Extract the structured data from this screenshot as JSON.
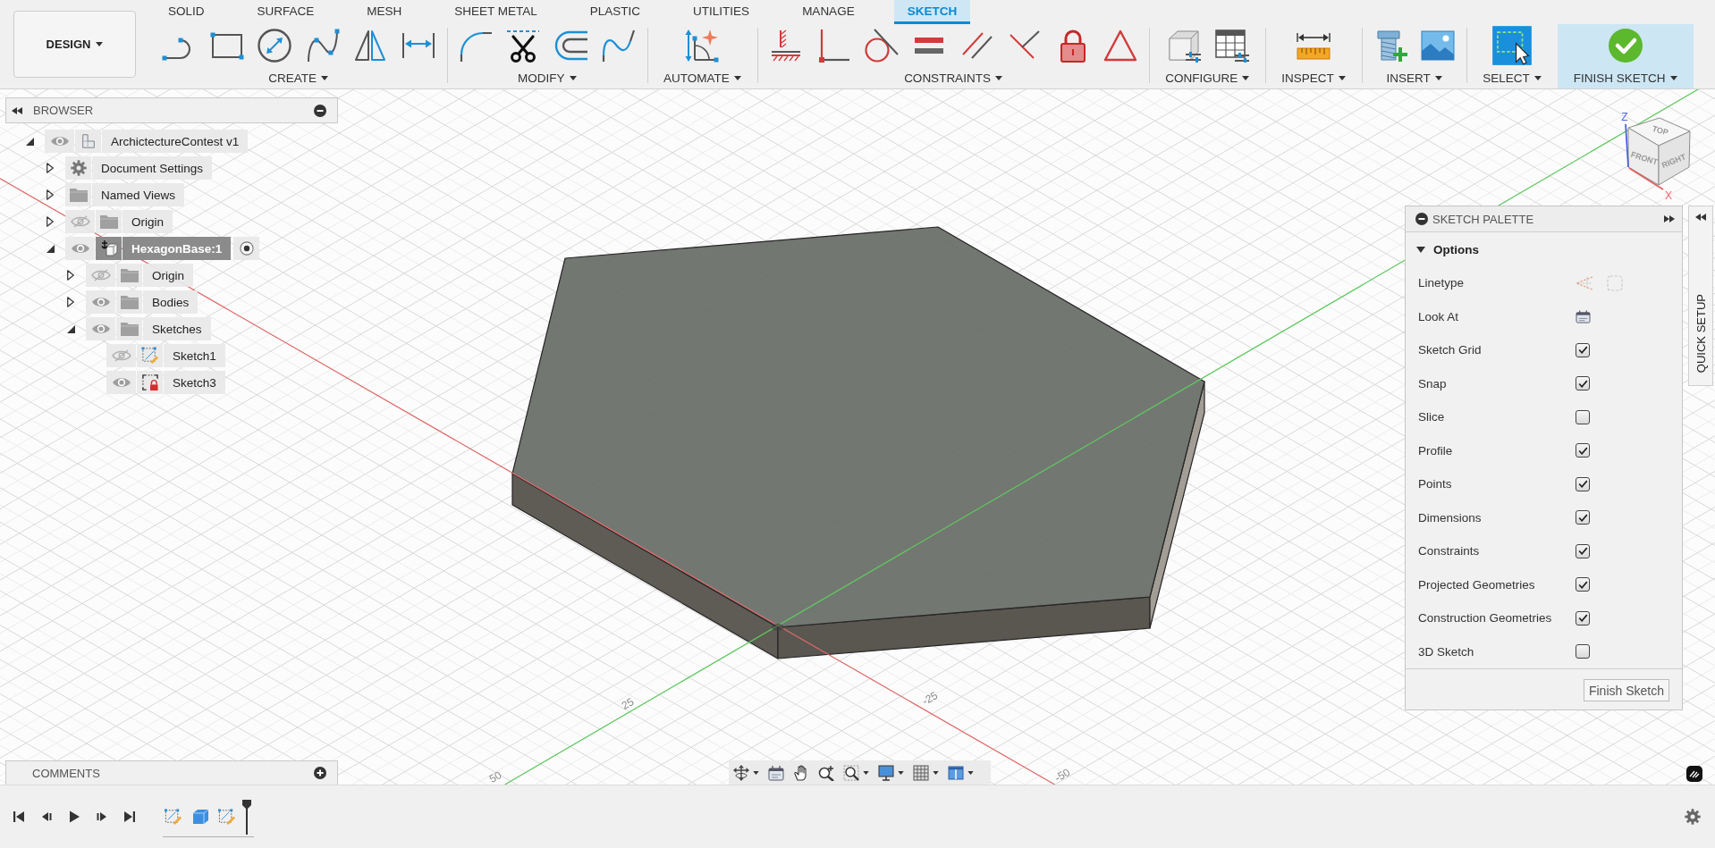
{
  "workspace_button": {
    "label": "DESIGN"
  },
  "tabs": [
    {
      "label": "SOLID",
      "selected": false
    },
    {
      "label": "SURFACE",
      "selected": false
    },
    {
      "label": "MESH",
      "selected": false
    },
    {
      "label": "SHEET METAL",
      "selected": false
    },
    {
      "label": "PLASTIC",
      "selected": false
    },
    {
      "label": "UTILITIES",
      "selected": false
    },
    {
      "label": "MANAGE",
      "selected": false
    },
    {
      "label": "SKETCH",
      "selected": true
    }
  ],
  "tool_groups": [
    {
      "label": "CREATE",
      "highlighted": false,
      "tools": [
        {
          "kind": "line"
        },
        {
          "kind": "rectangle"
        },
        {
          "kind": "circle"
        },
        {
          "kind": "spline"
        },
        {
          "kind": "mirror"
        },
        {
          "kind": "dimension"
        }
      ]
    },
    {
      "label": "MODIFY",
      "highlighted": false,
      "tools": [
        {
          "kind": "fillet"
        },
        {
          "kind": "trim"
        },
        {
          "kind": "offset"
        },
        {
          "kind": "extend"
        }
      ]
    },
    {
      "label": "AUTOMATE",
      "highlighted": false,
      "tools": [
        {
          "kind": "automate"
        }
      ]
    },
    {
      "label": "CONSTRAINTS",
      "highlighted": false,
      "tools": [
        {
          "kind": "horizontal"
        },
        {
          "kind": "coincident"
        },
        {
          "kind": "tangent"
        },
        {
          "kind": "equal"
        },
        {
          "kind": "parallel"
        },
        {
          "kind": "perpendicular"
        },
        {
          "kind": "fix"
        },
        {
          "kind": "symmetry"
        }
      ]
    },
    {
      "label": "CONFIGURE",
      "highlighted": false,
      "tools": [
        {
          "kind": "parameters"
        },
        {
          "kind": "table"
        }
      ]
    },
    {
      "label": "INSPECT",
      "highlighted": false,
      "tools": [
        {
          "kind": "measure"
        }
      ]
    },
    {
      "label": "INSERT",
      "highlighted": false,
      "tools": [
        {
          "kind": "insert"
        },
        {
          "kind": "image"
        }
      ]
    },
    {
      "label": "SELECT",
      "highlighted": false,
      "tools": [
        {
          "kind": "select"
        }
      ]
    },
    {
      "label": "FINISH SKETCH",
      "highlighted": true,
      "tools": [
        {
          "kind": "finish"
        }
      ]
    }
  ],
  "browser": {
    "title": "BROWSER",
    "tree": [
      {
        "label": "ArchictectureContest v1",
        "kind": "design",
        "visible": true,
        "expanded": true,
        "selected": false,
        "children": [
          {
            "label": "Document Settings",
            "kind": "settings",
            "expanded": false,
            "selected": false
          },
          {
            "label": "Named Views",
            "kind": "folder",
            "expanded": false,
            "selected": false
          },
          {
            "label": "Origin",
            "kind": "folder",
            "visible": false,
            "expanded": false,
            "selected": false
          },
          {
            "label": "HexagonBase:1",
            "kind": "component",
            "visible": true,
            "expanded": true,
            "selected": true,
            "active": true,
            "children": [
              {
                "label": "Origin",
                "kind": "folder",
                "visible": false,
                "expanded": false,
                "selected": false
              },
              {
                "label": "Bodies",
                "kind": "folder",
                "visible": true,
                "expanded": false,
                "selected": false
              },
              {
                "label": "Sketches",
                "kind": "folder",
                "visible": true,
                "expanded": true,
                "selected": false,
                "children": [
                  {
                    "label": "Sketch1",
                    "kind": "sketch",
                    "visible": false,
                    "locked": false,
                    "selected": false
                  },
                  {
                    "label": "Sketch3",
                    "kind": "sketch",
                    "visible": true,
                    "locked": true,
                    "selected": false
                  }
                ]
              }
            ]
          }
        ]
      }
    ]
  },
  "view_cube": {
    "top": "TOP",
    "front": "FRONT",
    "right": "RIGHT",
    "z_axis": "Z",
    "x_axis": "X"
  },
  "sketch_palette": {
    "title": "SKETCH PALETTE",
    "section": {
      "title": "Options",
      "expanded": true
    },
    "rows": [
      {
        "kind": "linetype",
        "label": "Linetype"
      },
      {
        "kind": "lookat",
        "label": "Look At"
      },
      {
        "kind": "checkbox",
        "label": "Sketch Grid",
        "checked": true
      },
      {
        "kind": "checkbox",
        "label": "Snap",
        "checked": true
      },
      {
        "kind": "checkbox",
        "label": "Slice",
        "checked": false
      },
      {
        "kind": "checkbox",
        "label": "Profile",
        "checked": true
      },
      {
        "kind": "checkbox",
        "label": "Points",
        "checked": true
      },
      {
        "kind": "checkbox",
        "label": "Dimensions",
        "checked": true
      },
      {
        "kind": "checkbox",
        "label": "Constraints",
        "checked": true
      },
      {
        "kind": "checkbox",
        "label": "Projected Geometries",
        "checked": true
      },
      {
        "kind": "checkbox",
        "label": "Construction Geometries",
        "checked": true
      },
      {
        "kind": "checkbox",
        "label": "3D Sketch",
        "checked": false
      }
    ],
    "finish_button": "Finish Sketch"
  },
  "quick_setup": {
    "label": "QUICK SETUP"
  },
  "viewport": {
    "axis_labels": [
      "25",
      "-25",
      "50",
      "-50"
    ]
  },
  "comments": {
    "title": "COMMENTS"
  },
  "navigation_bar": [
    {
      "kind": "orbit",
      "menu": true
    },
    {
      "kind": "look",
      "menu": false
    },
    {
      "kind": "pan",
      "menu": false
    },
    {
      "kind": "zoom",
      "menu": false
    },
    {
      "kind": "fit",
      "menu": true
    },
    {
      "kind": "display",
      "menu": true
    },
    {
      "kind": "grid",
      "menu": true
    },
    {
      "kind": "viewports",
      "menu": true
    }
  ],
  "timeline": {
    "features": [
      {
        "kind": "sketch"
      },
      {
        "kind": "extrude"
      },
      {
        "kind": "sketch"
      }
    ]
  }
}
